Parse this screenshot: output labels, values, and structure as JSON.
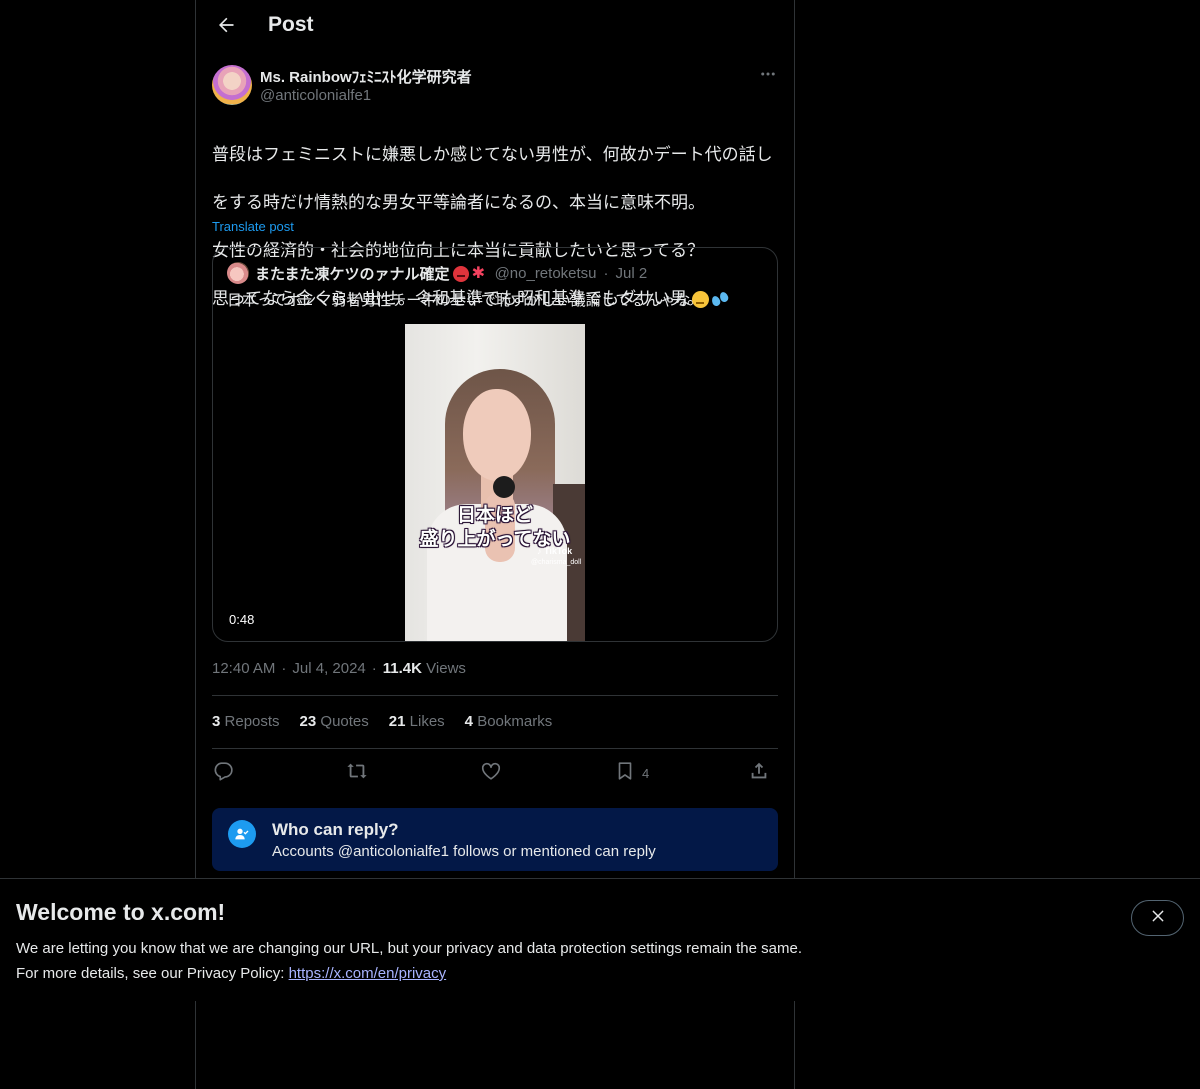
{
  "header": {
    "title": "Post"
  },
  "post": {
    "author_name": "Ms. Rainbowﾌｪﾐﾆｽﾄ化学研究者",
    "author_handle": "@anticolonialfe1",
    "text_line1": "普段はフェミニストに嫌悪しか感じてない男性が、何故かデート代の話し",
    "text_line2": "をする時だけ情熱的な男女平等論者になるの、本当に意味不明。",
    "text_line3": "女性の経済的・社会的地位向上に本当に貢献したいと思ってる？",
    "text_line4": "思ってなら金くらい出せ。令和基準でも昭和基準でもダサい男。",
    "translate_label": "Translate post",
    "time": "12:40 AM",
    "date": "Jul 4, 2024",
    "views_count": "11.4K",
    "views_label": "Views"
  },
  "quote": {
    "author_name": "またまた凍ケツのァナル確定",
    "author_handle": "@no_retoketsu",
    "date": "Jul 2",
    "text": "日本ってホンマ弱者男性チー牛のせいで恥ずかしい議論してるんゃな",
    "video": {
      "caption_line1": "日本ほど",
      "caption_line2": "盛り上がってない",
      "tiktok_label": "♪ TikTok",
      "tiktok_user": "@charisma_doll",
      "duration": "0:48"
    }
  },
  "stats": {
    "reposts_count": "3",
    "reposts_label": "Reposts",
    "quotes_count": "23",
    "quotes_label": "Quotes",
    "likes_count": "21",
    "likes_label": "Likes",
    "bookmarks_count": "4",
    "bookmarks_label": "Bookmarks"
  },
  "actions": {
    "reply_icon": "reply-icon",
    "repost_icon": "repost-icon",
    "like_icon": "heart-icon",
    "bookmark_icon": "bookmark-icon",
    "bookmark_count": "4",
    "share_icon": "share-icon"
  },
  "who_can_reply": {
    "title": "Who can reply?",
    "text": "Accounts @anticolonialfe1 follows or mentioned can reply"
  },
  "banner": {
    "title": "Welcome to x.com!",
    "line1": "We are letting you know that we are changing our URL, but your privacy and data protection settings remain the same.",
    "line2_prefix": "For more details, see our Privacy Policy: ",
    "link": "https://x.com/en/privacy"
  },
  "colors": {
    "background": "#000000",
    "text": "#e7e9ea",
    "muted": "#71767b",
    "accent": "#1d9bf0",
    "who_can_reply_bg": "#031847",
    "link": "#a9b4ff"
  }
}
